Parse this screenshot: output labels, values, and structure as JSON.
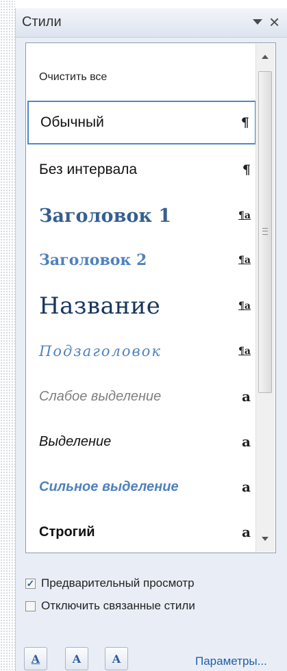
{
  "pane": {
    "title": "Стили",
    "menu_icon": "dropdown-arrow-icon",
    "close_label": "×"
  },
  "styles": [
    {
      "name": "Очистить все",
      "type": "",
      "kind": "clear"
    },
    {
      "name": "Обычный",
      "type": "¶",
      "kind": "paragraph",
      "selected": true
    },
    {
      "name": "Без интервала",
      "type": "¶",
      "kind": "paragraph"
    },
    {
      "name": "Заголовок 1",
      "type": "¶a",
      "kind": "linked"
    },
    {
      "name": "Заголовок 2",
      "type": "¶a",
      "kind": "linked"
    },
    {
      "name": "Название",
      "type": "¶a",
      "kind": "linked"
    },
    {
      "name": "Подзаголовок",
      "type": "¶a",
      "kind": "linked"
    },
    {
      "name": "Слабое выделение",
      "type": "a",
      "kind": "character"
    },
    {
      "name": "Выделение",
      "type": "a",
      "kind": "character"
    },
    {
      "name": "Сильное выделение",
      "type": "a",
      "kind": "character"
    },
    {
      "name": "Строгий",
      "type": "a",
      "kind": "character"
    }
  ],
  "options": {
    "preview": {
      "label": "Предварительный просмотр",
      "checked": true,
      "mark": "✓"
    },
    "disable_linked": {
      "label": "Отключить связанные стили",
      "checked": false,
      "mark": ""
    }
  },
  "buttons": {
    "new_style": "A",
    "style_inspector": "A",
    "manage_styles": "A"
  },
  "link": {
    "label": "Параметры..."
  },
  "colors": {
    "accent": "#4f81bd",
    "heading1": "#365f91",
    "title": "#17365d",
    "link": "#1f5fa8"
  }
}
